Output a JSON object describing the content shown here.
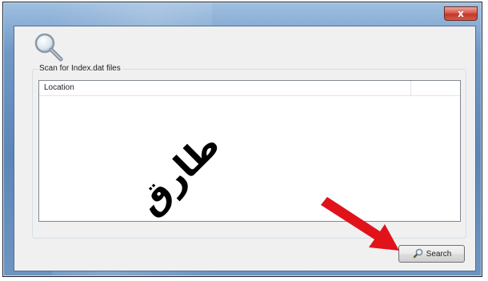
{
  "window": {
    "close_label": "x"
  },
  "scan": {
    "group_label": "Scan for Index.dat files",
    "columns": [
      "Location",
      ""
    ],
    "rows": []
  },
  "search_button": {
    "label": "Search",
    "icon": "search-icon"
  },
  "overlay": {
    "arrow_icon": "red-arrow-icon",
    "arrow_color": "#e0131b",
    "watermark": "طارق"
  },
  "colors": {
    "frame": "#6f98c6",
    "client_background": "#f0f0f0",
    "close_button": "#c0392b"
  }
}
